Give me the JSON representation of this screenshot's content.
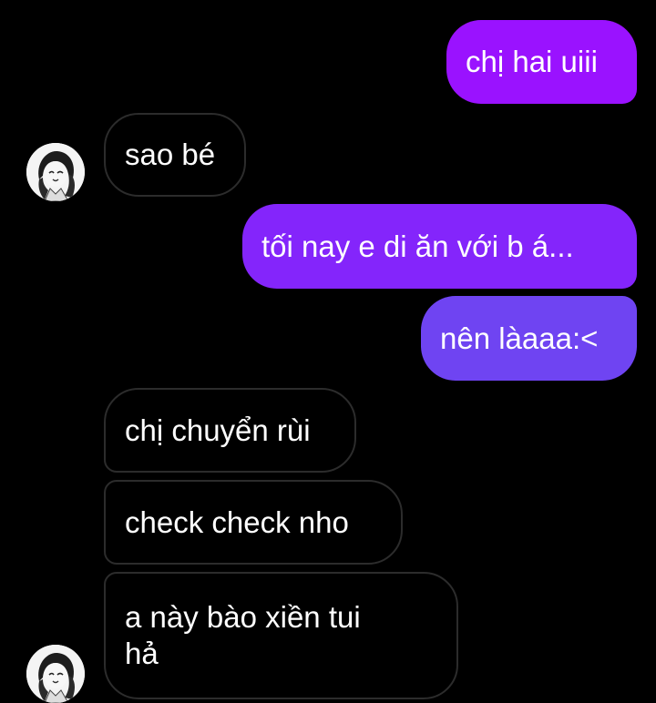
{
  "contact": {
    "avatar_icon": "contact-avatar"
  },
  "colors": {
    "background": "#000000",
    "outgoing_top": "#9a12ff",
    "outgoing_bottom": "#6f44f2",
    "incoming_border": "#2c2c2c",
    "text": "#ffffff"
  },
  "messages": [
    {
      "direction": "outgoing",
      "text": "chị hai uiii"
    },
    {
      "direction": "incoming",
      "text": "sao bé"
    },
    {
      "direction": "outgoing",
      "text": "tối nay e di ăn với b á..."
    },
    {
      "direction": "outgoing",
      "text": "nên làaaa:<"
    },
    {
      "direction": "incoming",
      "text": "chị chuyển rùi"
    },
    {
      "direction": "incoming",
      "text": "check check nho"
    },
    {
      "direction": "incoming",
      "text": "a này bào xiền tui hả"
    }
  ]
}
